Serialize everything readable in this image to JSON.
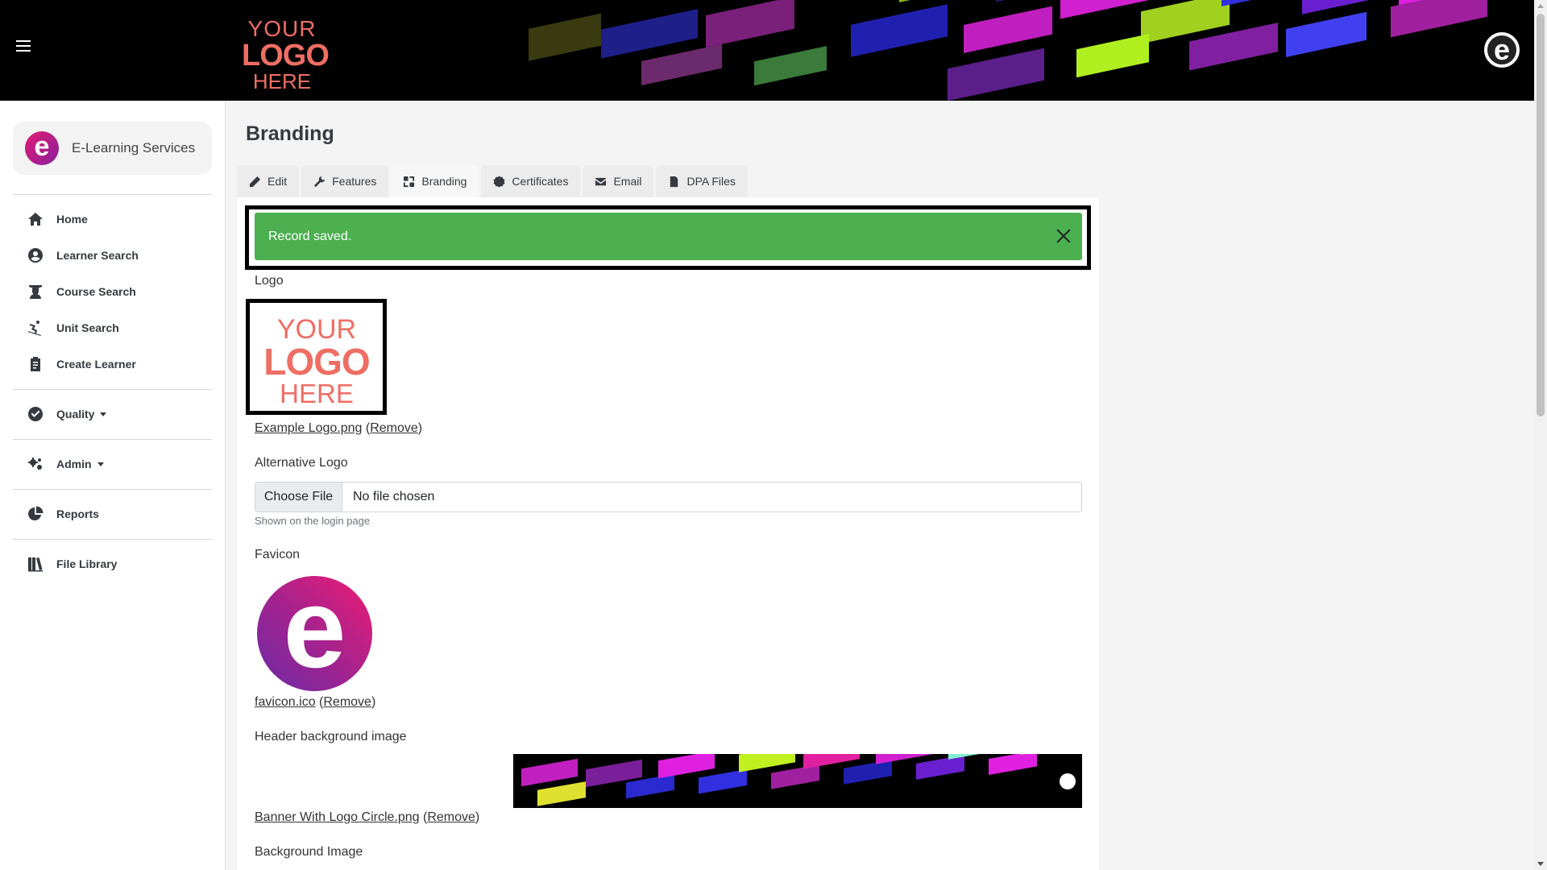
{
  "header": {
    "logo": {
      "line1": "YOUR",
      "line2": "LOGO",
      "line3": "HERE"
    },
    "brand_mark": "e"
  },
  "sidebar": {
    "org": {
      "mark": "e",
      "name": "E-Learning Services"
    },
    "items": [
      {
        "label": "Home",
        "icon": "home-icon"
      },
      {
        "label": "Learner Search",
        "icon": "user-circle-icon"
      },
      {
        "label": "Course Search",
        "icon": "graduate-icon"
      },
      {
        "label": "Unit Search",
        "icon": "skier-icon"
      },
      {
        "label": "Create Learner",
        "icon": "clipboard-icon"
      },
      {
        "label": "Quality",
        "icon": "check-circle-icon"
      },
      {
        "label": "Admin",
        "icon": "gears-icon"
      },
      {
        "label": "Reports",
        "icon": "pie-chart-icon"
      },
      {
        "label": "File Library",
        "icon": "book-library-icon"
      }
    ]
  },
  "page": {
    "title": "Branding"
  },
  "tabs": [
    {
      "label": "Edit",
      "icon": "pencil-icon"
    },
    {
      "label": "Features",
      "icon": "wrench-icon"
    },
    {
      "label": "Branding",
      "icon": "palette-icon",
      "active": true
    },
    {
      "label": "Certificates",
      "icon": "certificate-icon"
    },
    {
      "label": "Email",
      "icon": "envelope-icon"
    },
    {
      "label": "DPA Files",
      "icon": "file-icon"
    }
  ],
  "alert": {
    "message": "Record saved.",
    "color": "#4caf50"
  },
  "form": {
    "logo": {
      "label": "Logo",
      "preview": {
        "line1": "YOUR",
        "line2": "LOGO",
        "line3": "HERE"
      },
      "filename": "Example Logo.png",
      "remove": "Remove"
    },
    "alt_logo": {
      "label": "Alternative Logo",
      "button": "Choose File",
      "status": "No file chosen",
      "help": "Shown on the login page"
    },
    "favicon": {
      "label": "Favicon",
      "mark": "e",
      "filename": "favicon.ico",
      "remove": "Remove"
    },
    "header_bg": {
      "label": "Header background image",
      "filename": "Banner With Logo Circle.png",
      "remove": "Remove"
    },
    "bg_image": {
      "label": "Background Image"
    }
  }
}
